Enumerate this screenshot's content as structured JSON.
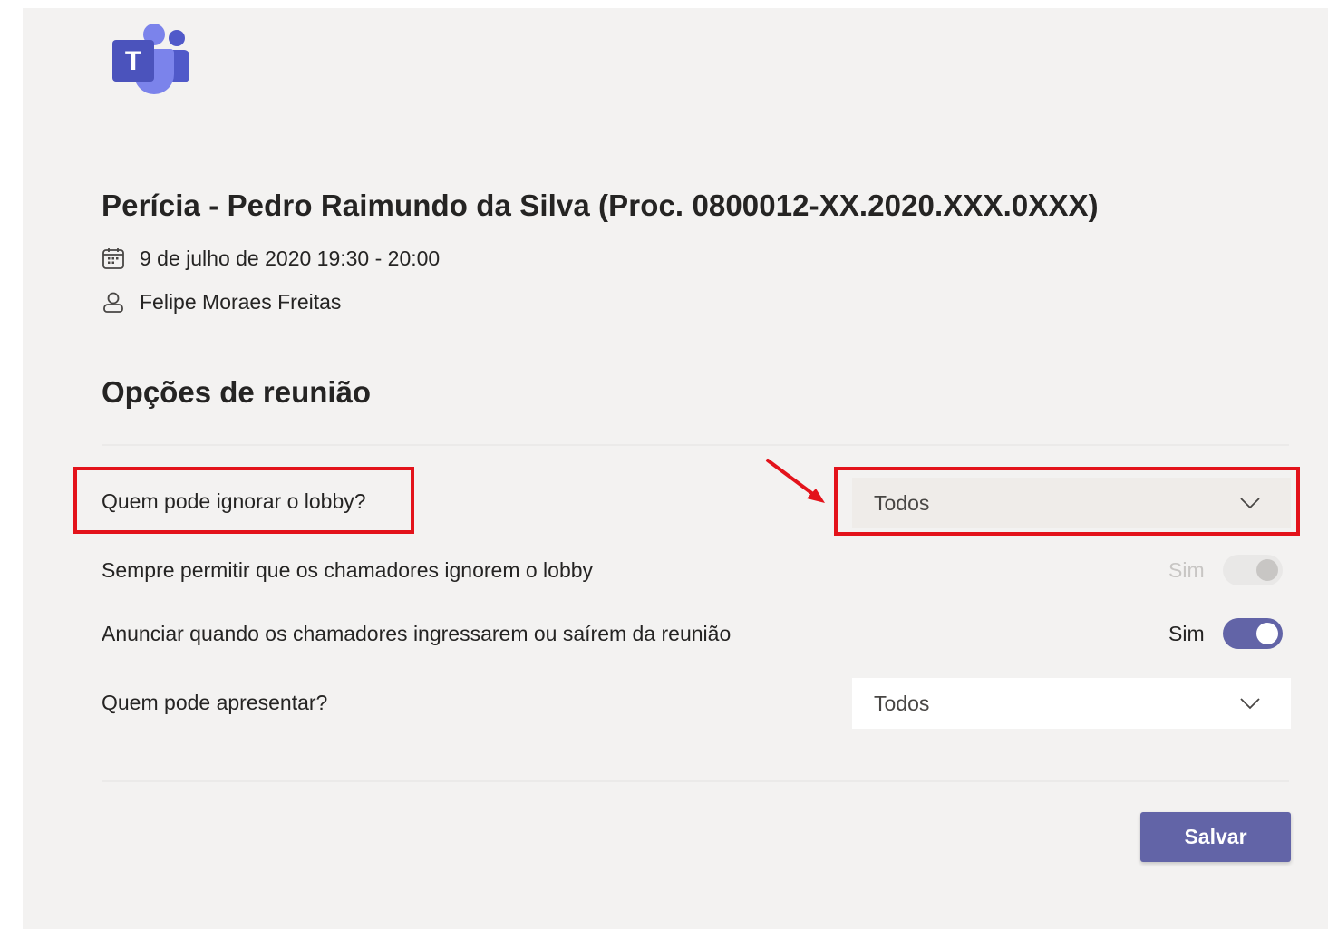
{
  "meeting": {
    "title": "Perícia - Pedro Raimundo da Silva (Proc. 0800012-XX.2020.XXX.0XXX)",
    "datetime": "9 de julho de 2020 19:30 - 20:00",
    "organizer": "Felipe Moraes Freitas"
  },
  "section": {
    "title": "Opções de reunião"
  },
  "options": {
    "bypass_lobby": {
      "label": "Quem pode ignorar o lobby?",
      "selected": "Todos"
    },
    "callers_bypass": {
      "label": "Sempre permitir que os chamadores ignorem o lobby",
      "state_label": "Sim",
      "enabled": false
    },
    "announce_callers": {
      "label": "Anunciar quando os chamadores ingressarem ou saírem da reunião",
      "state_label": "Sim",
      "enabled": true
    },
    "presenters": {
      "label": "Quem pode apresentar?",
      "selected": "Todos"
    }
  },
  "actions": {
    "save_label": "Salvar"
  },
  "icons": {
    "logo": "teams-logo-icon",
    "date": "calendar-icon",
    "organizer": "person-icon",
    "dropdown": "chevron-down-icon"
  },
  "colors": {
    "accent": "#6264a7",
    "background": "#f3f2f1",
    "annotation": "#e3131b"
  }
}
